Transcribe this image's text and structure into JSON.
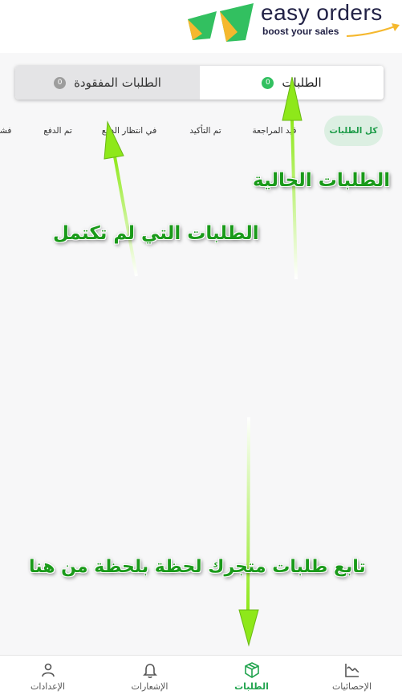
{
  "brand": {
    "name": "easy orders",
    "tagline": "boost your sales",
    "colors": {
      "green": "#32c060",
      "yellow": "#f5b82e",
      "navy": "#222246"
    }
  },
  "order_tabs": [
    {
      "label": "الطلبات",
      "count": "0",
      "active": true
    },
    {
      "label": "الطلبات المفقودة",
      "count": "0",
      "active": false
    }
  ],
  "status_filters": [
    {
      "label": "كل الطلبات",
      "active": true
    },
    {
      "label": "قيد المراجعة",
      "active": false
    },
    {
      "label": "تم التأكيد",
      "active": false
    },
    {
      "label": "في انتظار الدفع",
      "active": false
    },
    {
      "label": "تم الدفع",
      "active": false
    },
    {
      "label": "فشل",
      "active": false
    }
  ],
  "annotations": {
    "current_orders": "الطلبات الحالية",
    "incomplete_orders": "الطلبات التي لم تكتمل",
    "follow_orders": "تابع طلبات متجرك لحظة بلحظة من هنا"
  },
  "bottom_nav": [
    {
      "label": "الإحصائيات",
      "icon": "chart-icon",
      "active": false
    },
    {
      "label": "الطلبات",
      "icon": "box-icon",
      "active": true
    },
    {
      "label": "الإشعارات",
      "icon": "bell-icon",
      "active": false
    },
    {
      "label": "الإعدادات",
      "icon": "user-icon",
      "active": false
    }
  ]
}
